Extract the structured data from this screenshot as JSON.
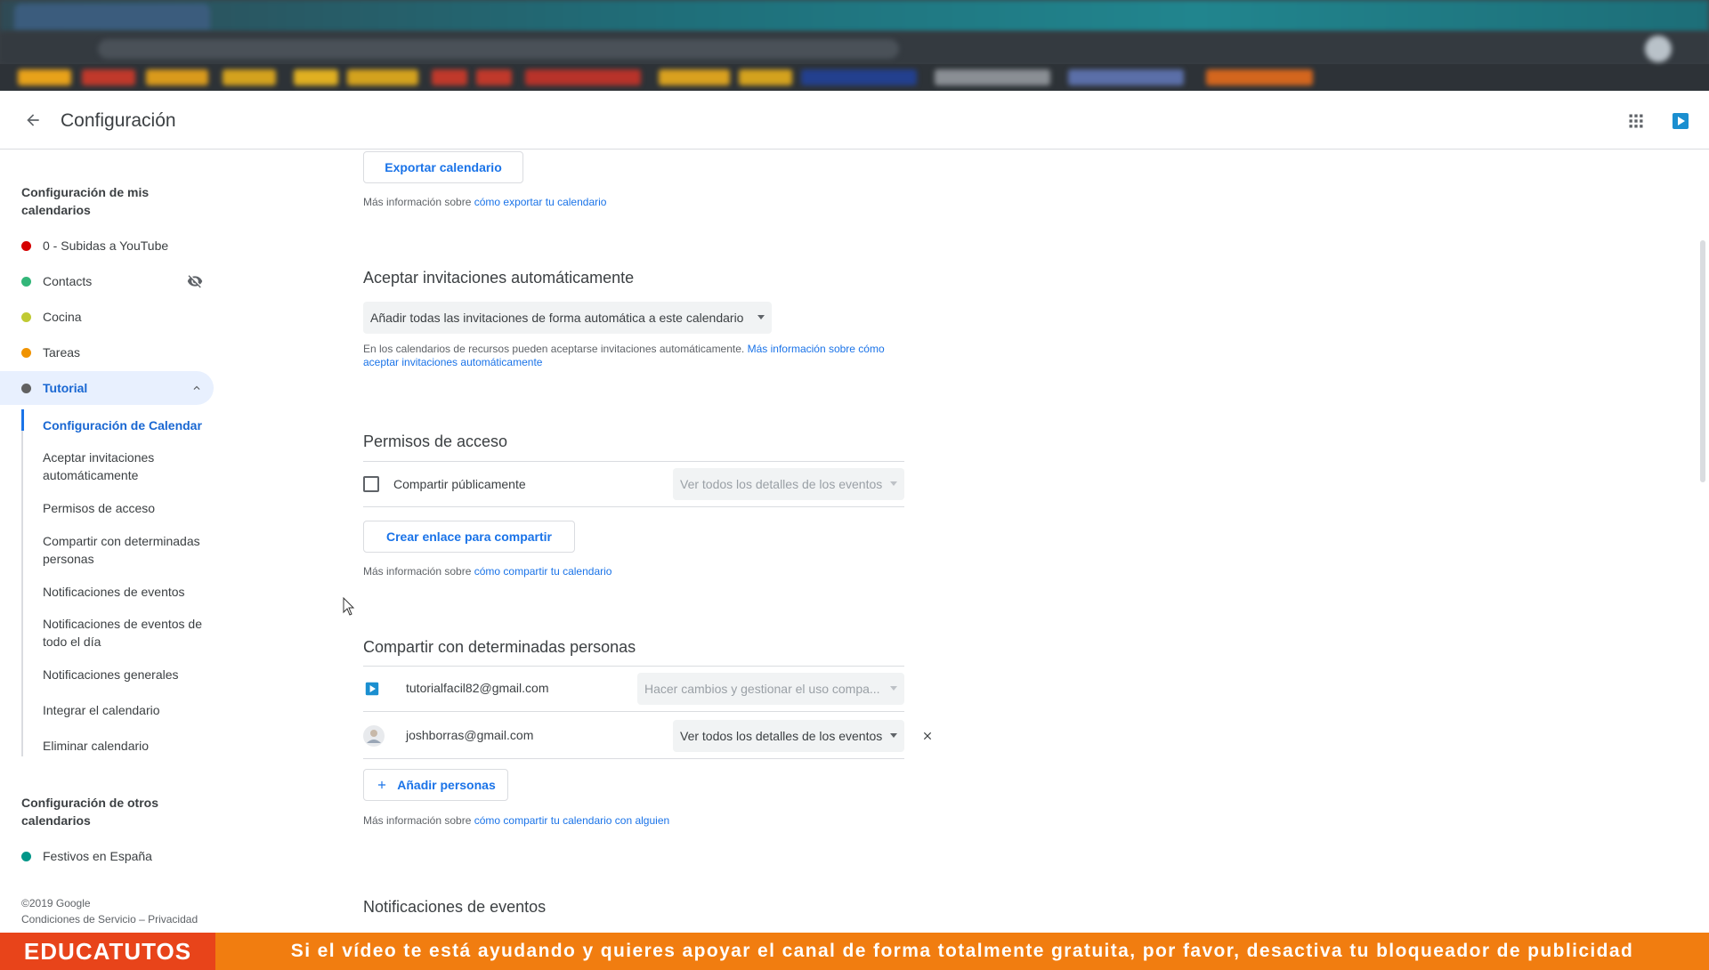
{
  "header": {
    "title": "Configuración"
  },
  "sidebar": {
    "heading_my": "Configuración de mis calendarios",
    "calendars": [
      {
        "label": "0 - Subidas a YouTube",
        "color": "#d50000"
      },
      {
        "label": "Contacts",
        "color": "#33b679"
      },
      {
        "label": "Cocina",
        "color": "#c0ca33"
      },
      {
        "label": "Tareas",
        "color": "#f09300"
      },
      {
        "label": "Tutorial",
        "color": "#616161"
      }
    ],
    "sub_items": [
      "Configuración de Calendar",
      "Aceptar invitaciones automáticamente",
      "Permisos de acceso",
      "Compartir con determinadas personas",
      "Notificaciones de eventos",
      "Notificaciones de eventos de todo el día",
      "Notificaciones generales",
      "Integrar el calendario",
      "Eliminar calendario"
    ],
    "heading_other": "Configuración de otros calendarios",
    "other_calendars": [
      {
        "label": "Festivos en España",
        "color": "#009688"
      }
    ],
    "footer_copyright": "©2019 Google",
    "footer_terms": "Condiciones de Servicio",
    "footer_sep": " – ",
    "footer_privacy": "Privacidad"
  },
  "main": {
    "export_button": "Exportar calendario",
    "export_info_prefix": "Más información sobre ",
    "export_info_link": "cómo exportar tu calendario",
    "auto_accept_title": "Aceptar invitaciones automáticamente",
    "auto_accept_value": "Añadir todas las invitaciones de forma automática a este calendario",
    "auto_accept_info": "En los calendarios de recursos pueden aceptarse invitaciones automáticamente. ",
    "auto_accept_link": "Más información sobre cómo aceptar invitaciones automáticamente",
    "access_title": "Permisos de acceso",
    "share_public_label": "Compartir públicamente",
    "share_public_dropdown": "Ver todos los detalles de los eventos",
    "create_link_button": "Crear enlace para compartir",
    "share_info_prefix": "Más información sobre ",
    "share_info_link": "cómo compartir tu calendario",
    "share_people_title": "Compartir con determinadas personas",
    "people": [
      {
        "email": "tutorialfacil82@gmail.com",
        "permission": "Hacer cambios y gestionar el uso compa..."
      },
      {
        "email": "joshborras@gmail.com",
        "permission": "Ver todos los detalles de los eventos"
      }
    ],
    "add_people_button": "Añadir personas",
    "people_info_prefix": "Más información sobre ",
    "people_info_link": "cómo compartir tu calendario con alguien",
    "notifications_title": "Notificaciones de eventos"
  },
  "banner": {
    "brand": "EDUCATUTOS",
    "message": "Si el vídeo te está ayudando y quieres apoyar el canal de forma totalmente gratuita, por favor, desactiva tu bloqueador de publicidad"
  }
}
